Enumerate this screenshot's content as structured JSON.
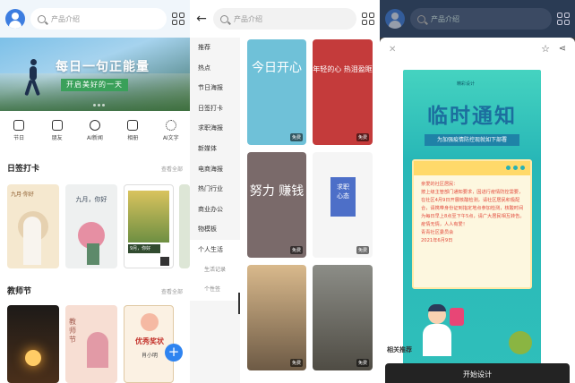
{
  "search": {
    "placeholder": "产品介绍"
  },
  "home": {
    "banner_title": "每日一句正能量",
    "banner_sub": "开启美好的一天",
    "categories": [
      "节日",
      "朋友",
      "AI新闻",
      "相册",
      "AI文字"
    ],
    "section1": "日签打卡",
    "section1_more": "查看全部",
    "card_dates": [
      "九月·你好",
      "九月，你好",
      "9月，你好"
    ],
    "section2": "教师节",
    "section2_more": "查看全部",
    "teacher_cards": [
      "教师节",
      "优秀奖状",
      "肖小明"
    ]
  },
  "category": {
    "items": [
      "推荐",
      "热点",
      "节日海报",
      "日签打卡",
      "求职海报",
      "新媒体",
      "电商海报",
      "热门行业",
      "商业办公",
      "物模板",
      "个人生活",
      "生活记录",
      "个性签"
    ],
    "templates": [
      {
        "title": "今日开心",
        "tag": "免费"
      },
      {
        "title": "年轻的心 热泪盈眶",
        "tag": "免费"
      },
      {
        "title": "努力 赚钱",
        "tag": "免费"
      },
      {
        "title": "求职 心态",
        "tag": "免费"
      },
      {
        "title": "",
        "tag": "免费"
      },
      {
        "title": "",
        "tag": "免费"
      }
    ]
  },
  "detail": {
    "brand": "精彩设计",
    "title": "临时通知",
    "subtitle": "为加强疫情防控现就如下部署",
    "body": "亲爱的社区居民：\n按上级主管部门通知要求，因进行疫情防控需要，在社区4月9日开展核酸检测，请社区居民积极配合，请携带身份证到指定地点参加检测，核酸时间为每日早上8点至下午5点，请广大居民相互转告。\n疫情无情，人人有爱！\n青青社区委员会\n2021年6月9日",
    "related": "相关推荐",
    "start_button": "开始设计"
  },
  "colors": {
    "accent": "#2f84f0",
    "header_dark": "#2a3b54"
  }
}
